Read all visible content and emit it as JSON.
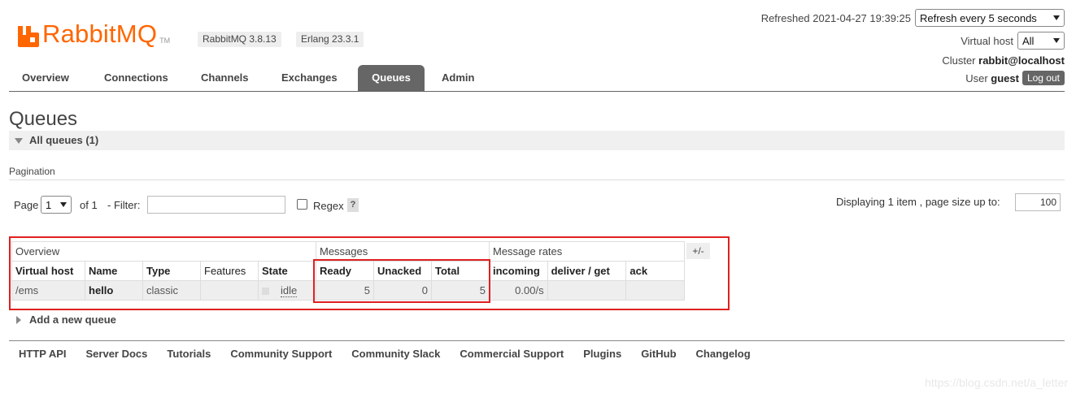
{
  "brand": {
    "logo_text": "RabbitMQ",
    "tm": "TM",
    "rabbitmq_version": "RabbitMQ 3.8.13",
    "erlang_version": "Erlang 23.3.1",
    "brand_color": "#ff6600"
  },
  "top_right": {
    "refreshed": "Refreshed 2021-04-27 19:39:25",
    "refresh_select": "Refresh every 5 seconds",
    "vhost_label": "Virtual host",
    "vhost_select": "All",
    "cluster_label": "Cluster",
    "cluster_name": "rabbit@localhost",
    "user_label": "User",
    "user_name": "guest",
    "logout": "Log out"
  },
  "nav": {
    "tabs": [
      {
        "label": "Overview"
      },
      {
        "label": "Connections"
      },
      {
        "label": "Channels"
      },
      {
        "label": "Exchanges"
      },
      {
        "label": "Queues",
        "active": true
      },
      {
        "label": "Admin"
      }
    ]
  },
  "page": {
    "title": "Queues",
    "section": "All queues (1)",
    "pagination_label": "Pagination",
    "page_label": "Page",
    "page_select": "1",
    "of_label": "of 1",
    "filter_label": "- Filter:",
    "filter_value": "",
    "regex_label": "Regex",
    "help": "?",
    "displaying": "Displaying 1 item , page size up to:",
    "page_size": "100"
  },
  "table": {
    "groups": [
      "Overview",
      "Messages",
      "Message rates"
    ],
    "toggle": "+/-",
    "headers": [
      "Virtual host",
      "Name",
      "Type",
      "Features",
      "State",
      "Ready",
      "Unacked",
      "Total",
      "incoming",
      "deliver / get",
      "ack"
    ],
    "row": {
      "vhost": "/ems",
      "name": "hello",
      "type": "classic",
      "features": "",
      "state": "idle",
      "ready": "5",
      "unacked": "0",
      "total": "5",
      "incoming": "0.00/s",
      "deliver_get": "",
      "ack": ""
    }
  },
  "add_queue": "Add a new queue",
  "footer": [
    "HTTP API",
    "Server Docs",
    "Tutorials",
    "Community Support",
    "Community Slack",
    "Commercial Support",
    "Plugins",
    "GitHub",
    "Changelog"
  ],
  "watermark": "https://blog.csdn.net/a_letter",
  "highlight_color": "#e02020"
}
